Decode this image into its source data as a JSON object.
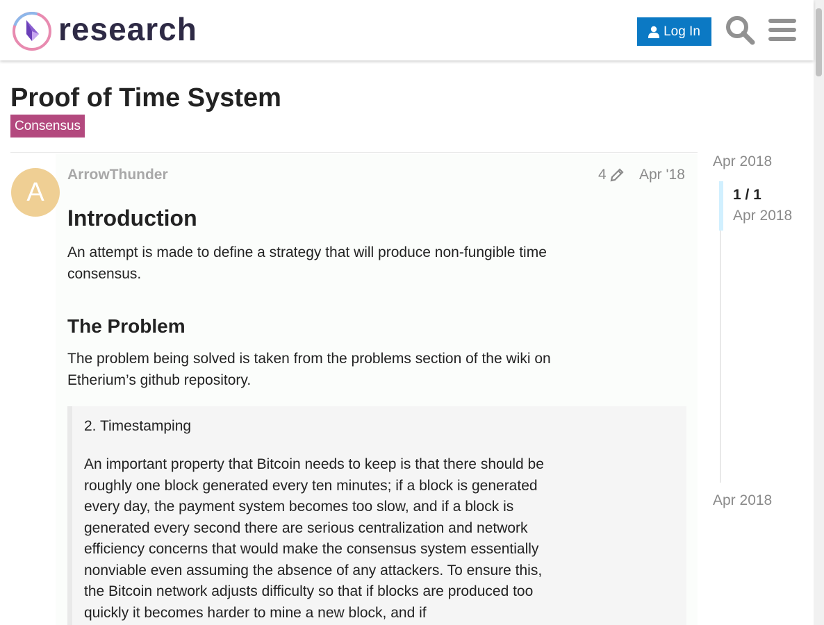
{
  "header": {
    "brand": "research",
    "login_label": "Log In"
  },
  "topic": {
    "title": "Proof of Time System",
    "category": "Consensus"
  },
  "post": {
    "avatar_letter": "A",
    "username": "ArrowThunder",
    "edit_count": "4",
    "date": "Apr '18",
    "intro_heading": "Introduction",
    "intro_text": "An attempt is made to define a strategy that will produce non-fungible time consensus.",
    "problem_heading": "The Problem",
    "problem_text": "The problem being solved is taken from the problems section of the wiki on Etherium’s github repository.",
    "quote_title": "2. Timestamping",
    "quote_text": "An important property that Bitcoin needs to keep is that there should be roughly one block generated every ten minutes; if a block is generated every day, the payment system becomes too slow, and if a block is generated every second there are serious centralization and network efficiency concerns that would make the consensus system essentially nonviable even assuming the absence of any attackers. To ensure this, the Bitcoin network adjusts difficulty so that if blocks are produced too quickly it becomes harder to mine a new block, and if"
  },
  "timeline": {
    "start": "Apr 2018",
    "position": "1 / 1",
    "position_date": "Apr 2018",
    "end": "Apr 2018"
  },
  "colors": {
    "accent": "#0b79c4",
    "category": "#b3497e",
    "avatar": "#efcf94"
  },
  "icons": [
    "logo-icon",
    "user-icon",
    "search-icon",
    "hamburger-menu-icon",
    "pencil-icon"
  ]
}
